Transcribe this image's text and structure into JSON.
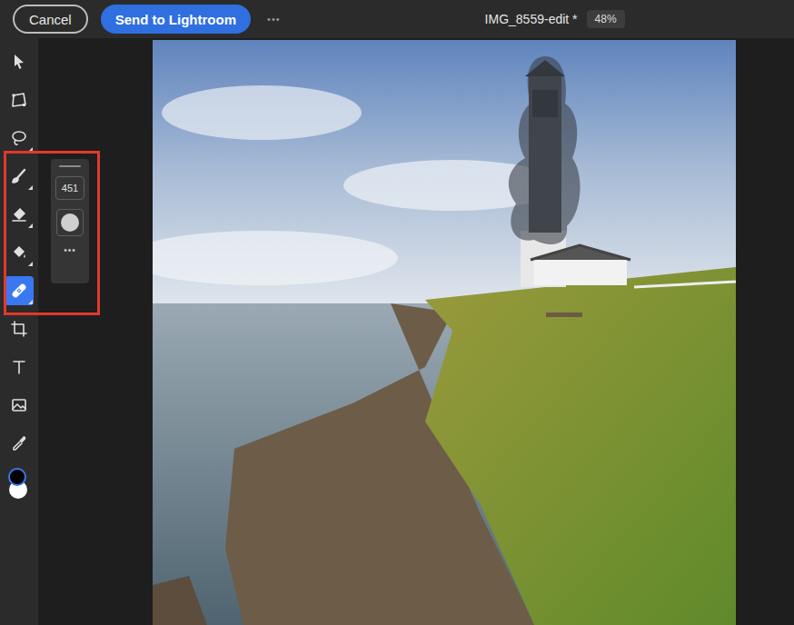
{
  "top_bar": {
    "cancel": "Cancel",
    "send": "Send to Lightroom",
    "more": "•••"
  },
  "document": {
    "title": "IMG_8559-edit *",
    "zoom": "48%"
  },
  "tools": [
    {
      "kind": "select",
      "selected": false,
      "has_menu": false
    },
    {
      "kind": "transform",
      "selected": false,
      "has_menu": false
    },
    {
      "kind": "lasso",
      "selected": false,
      "has_menu": true
    },
    {
      "kind": "brush",
      "selected": false,
      "has_menu": true
    },
    {
      "kind": "eraser",
      "selected": false,
      "has_menu": true
    },
    {
      "kind": "fill",
      "selected": false,
      "has_menu": true
    },
    {
      "kind": "heal",
      "selected": true,
      "has_menu": true
    },
    {
      "kind": "crop",
      "selected": false,
      "has_menu": false
    },
    {
      "kind": "text",
      "selected": false,
      "has_menu": false
    },
    {
      "kind": "image",
      "selected": false,
      "has_menu": false
    },
    {
      "kind": "eyedropper",
      "selected": false,
      "has_menu": false
    }
  ],
  "brush_options": {
    "size": "451",
    "more": "•••"
  },
  "colors": {
    "foreground": "#000000",
    "background": "#ffffff"
  }
}
